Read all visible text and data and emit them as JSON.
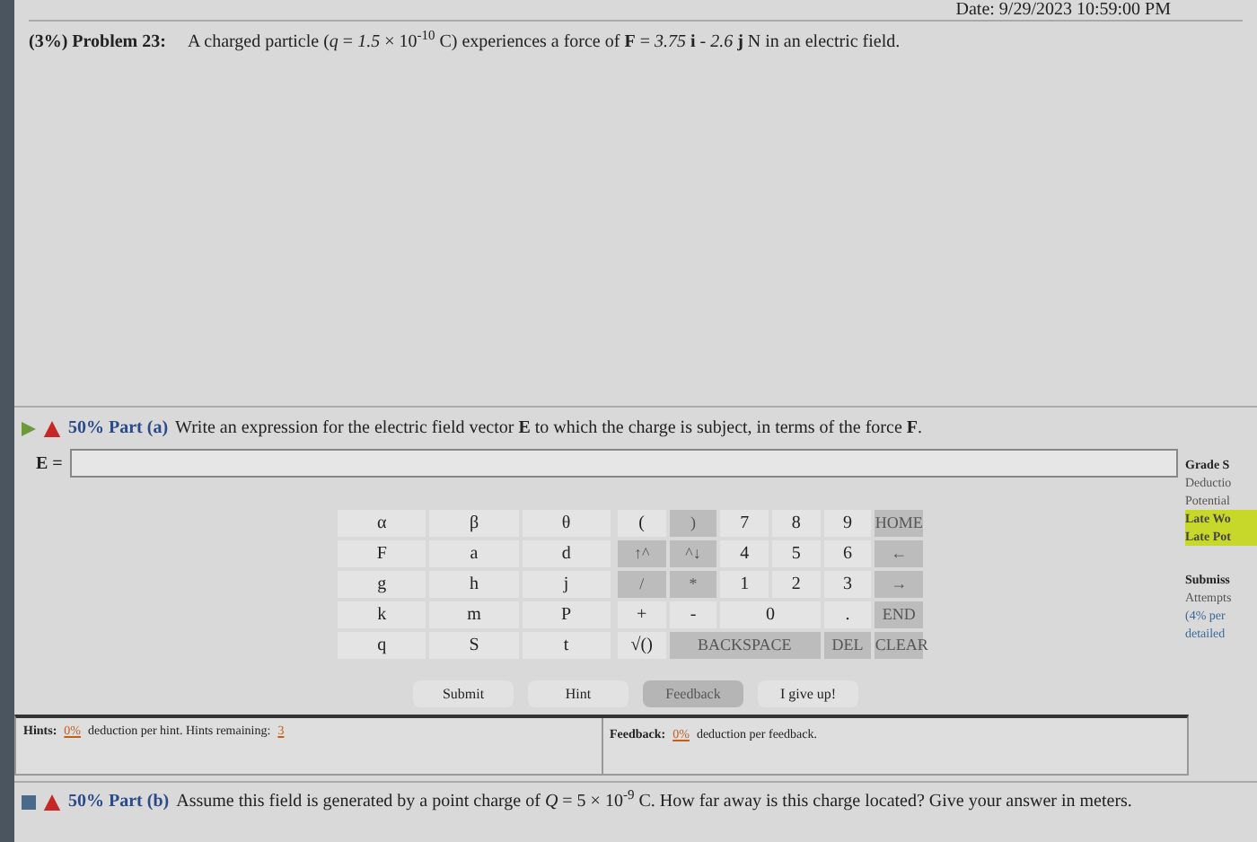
{
  "header": {
    "date": "Date: 9/29/2023 10:59:00 PM",
    "problem_label": "(3%) Problem 23:",
    "problem_text": "A charged particle (*q* = *1.5* × 10$^{-10}$ C) experiences a force of **F** = *3.75* **i** - *2.6* **j** N in an electric field."
  },
  "part_a": {
    "weight": "50% Part (a)",
    "question": "Write an expression for the electric field vector **E** to which the charge is subject, in terms of the force **F**.",
    "field_label": "E =",
    "expanded": true
  },
  "side_panel": [
    {
      "text": "Grade S",
      "kind": "heading"
    },
    {
      "text": "Deductio",
      "kind": "plain"
    },
    {
      "text": "Potential",
      "kind": "plain"
    },
    {
      "text": "Late Wo",
      "kind": "highlight"
    },
    {
      "text": "Late Pot",
      "kind": "highlight"
    },
    {
      "text": "Submiss",
      "kind": "heading"
    },
    {
      "text": "Attempts",
      "kind": "plain"
    },
    {
      "text": "(4% per",
      "kind": "link"
    },
    {
      "text": "detailed",
      "kind": "link"
    }
  ],
  "variables": [
    [
      "α",
      "β",
      "θ"
    ],
    [
      "F",
      "a",
      "d"
    ],
    [
      "g",
      "h",
      "j"
    ],
    [
      "k",
      "m",
      "P"
    ],
    [
      "q",
      "S",
      "t"
    ]
  ],
  "keypad": [
    [
      {
        "label": "(",
        "kind": "single",
        "disabled": false
      },
      {
        "label": ")",
        "kind": "single",
        "disabled": true
      },
      {
        "label": "7",
        "kind": "single",
        "disabled": false
      },
      {
        "label": "8",
        "kind": "single",
        "disabled": false
      },
      {
        "label": "9",
        "kind": "single",
        "disabled": false
      },
      {
        "label": "HOME",
        "kind": "single",
        "disabled": true
      }
    ],
    [
      {
        "label": "↑^",
        "kind": "single",
        "disabled": true
      },
      {
        "label": "^↓",
        "kind": "single",
        "disabled": true
      },
      {
        "label": "4",
        "kind": "single",
        "disabled": false
      },
      {
        "label": "5",
        "kind": "single",
        "disabled": false
      },
      {
        "label": "6",
        "kind": "single",
        "disabled": false
      },
      {
        "label": "←",
        "kind": "single",
        "disabled": true
      }
    ],
    [
      {
        "label": "/",
        "kind": "single",
        "disabled": true
      },
      {
        "label": "*",
        "kind": "single",
        "disabled": true
      },
      {
        "label": "1",
        "kind": "single",
        "disabled": false
      },
      {
        "label": "2",
        "kind": "single",
        "disabled": false
      },
      {
        "label": "3",
        "kind": "single",
        "disabled": false
      },
      {
        "label": "→",
        "kind": "single",
        "disabled": true
      }
    ],
    [
      {
        "label": "+",
        "kind": "single",
        "disabled": false
      },
      {
        "label": "-",
        "kind": "single",
        "disabled": false
      },
      {
        "label": "0",
        "kind": "double",
        "disabled": false
      },
      {
        "label": ".",
        "kind": "single",
        "disabled": false
      },
      {
        "label": "END",
        "kind": "single",
        "disabled": true
      }
    ],
    [
      {
        "label": "√()",
        "kind": "single",
        "disabled": false
      },
      {
        "label": "BACKSPACE",
        "kind": "triple",
        "disabled": true
      },
      {
        "label": "DEL",
        "kind": "single",
        "disabled": true
      },
      {
        "label": "CLEAR",
        "kind": "single",
        "disabled": true
      }
    ]
  ],
  "buttons": [
    {
      "label": "Submit",
      "disabled": false
    },
    {
      "label": "Hint",
      "disabled": false
    },
    {
      "label": "Feedback",
      "disabled": true
    },
    {
      "label": "I give up!",
      "disabled": false
    }
  ],
  "hints": {
    "label": "Hints:",
    "deduction": "0%",
    "text": "deduction per hint. Hints remaining:",
    "remaining": "3"
  },
  "feedback": {
    "label": "Feedback:",
    "deduction": "0%",
    "text": "deduction per feedback."
  },
  "part_b": {
    "weight": "50% Part (b)",
    "question": "Assume this field is generated by a point charge of *Q* = 5 × 10$^{-9}$ C. How far away is this charge located? Give your answer in meters.",
    "expanded": false
  }
}
